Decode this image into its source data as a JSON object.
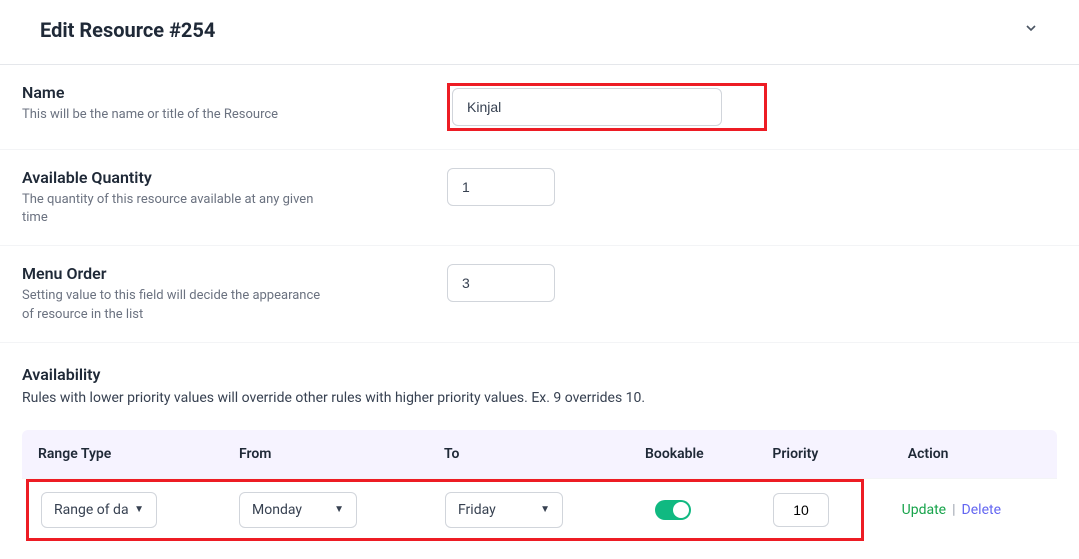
{
  "header": {
    "title": "Edit Resource #254"
  },
  "fields": {
    "name": {
      "label": "Name",
      "help": "This will be the name or title of the Resource",
      "value": "Kinjal"
    },
    "quantity": {
      "label": "Available Quantity",
      "help": "The quantity of this resource available at any given time",
      "value": "1"
    },
    "menu_order": {
      "label": "Menu Order",
      "help": "Setting value to this field will decide the appearance of resource in the list",
      "value": "3"
    }
  },
  "availability": {
    "title": "Availability",
    "help": "Rules with lower priority values will override other rules with higher priority values. Ex. 9 overrides 10.",
    "columns": {
      "range_type": "Range Type",
      "from": "From",
      "to": "To",
      "bookable": "Bookable",
      "priority": "Priority",
      "action": "Action"
    },
    "rows": [
      {
        "range_type": "Range of days",
        "from": "Monday",
        "to": "Friday",
        "bookable": true,
        "priority": "10"
      }
    ],
    "actions": {
      "update": "Update",
      "delete": "Delete"
    }
  }
}
